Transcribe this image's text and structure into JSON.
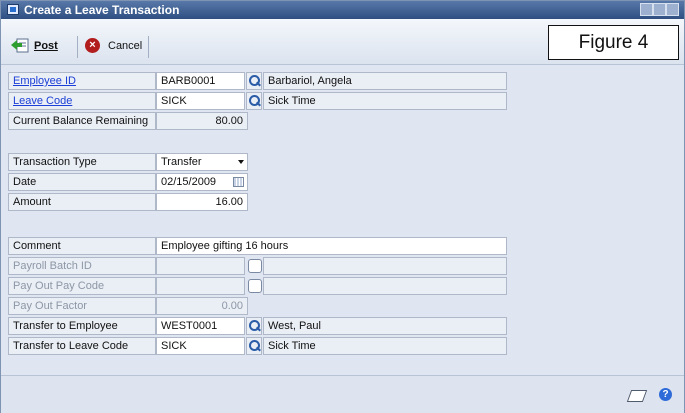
{
  "window": {
    "title": "Create a Leave Transaction",
    "figure_label": "Figure 4"
  },
  "toolbar": {
    "post_label": "Post",
    "cancel_label": "Cancel"
  },
  "form": {
    "employee_id": {
      "label": "Employee ID",
      "value": "BARB0001",
      "description": "Barbariol, Angela"
    },
    "leave_code": {
      "label": "Leave Code",
      "value": "SICK",
      "description": "Sick Time"
    },
    "current_balance": {
      "label": "Current Balance Remaining",
      "value": "80.00"
    },
    "transaction_type": {
      "label": "Transaction Type",
      "value": "Transfer"
    },
    "date": {
      "label": "Date",
      "value": "02/15/2009"
    },
    "amount": {
      "label": "Amount",
      "value": "16.00"
    },
    "comment": {
      "label": "Comment",
      "value": "Employee gifting 16 hours"
    },
    "payroll_batch_id": {
      "label": "Payroll Batch ID"
    },
    "pay_out_pay_code": {
      "label": "Pay Out Pay Code"
    },
    "pay_out_factor": {
      "label": "Pay Out Factor",
      "value": "0.00"
    },
    "transfer_employee": {
      "label": "Transfer to Employee",
      "value": "WEST0001",
      "description": "West, Paul"
    },
    "transfer_leave_code": {
      "label": "Transfer to Leave Code",
      "value": "SICK",
      "description": "Sick Time"
    }
  },
  "icons": {
    "window": "window-icon",
    "post": "post-icon",
    "cancel": "cancel-icon",
    "lookup": "lookup-icon",
    "dropdown": "chevron-down-icon",
    "calendar": "calendar-icon",
    "note": "note-icon",
    "help": "help-icon"
  },
  "colors": {
    "link": "#1b3fd6",
    "titlebar": "#2f4f83",
    "cancel": "#b21d1d"
  }
}
